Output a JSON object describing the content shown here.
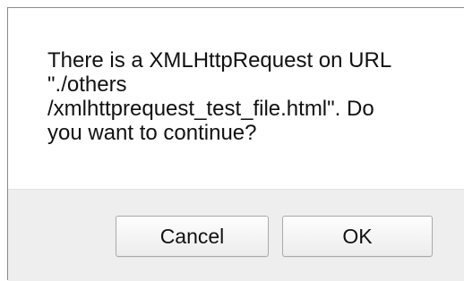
{
  "dialog": {
    "message": "There is a XMLHttpRequest on URL\n\"./others\n/xmlhttprequest_test_file.html\". Do\nyou want to continue?",
    "buttons": {
      "cancel_label": "Cancel",
      "ok_label": "OK"
    }
  }
}
